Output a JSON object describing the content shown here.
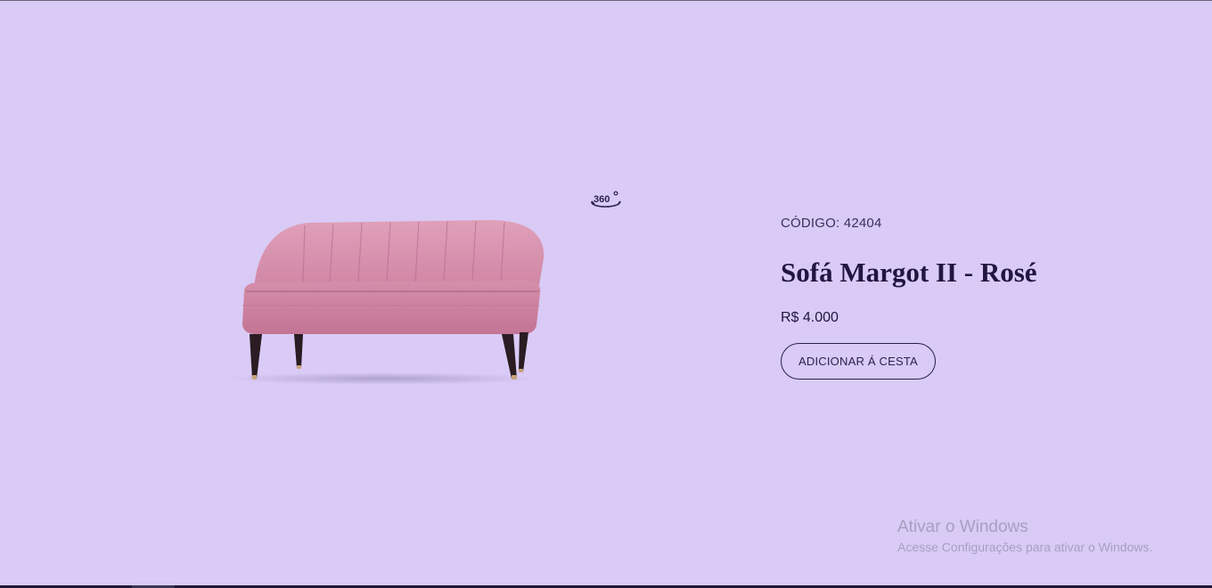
{
  "product": {
    "code_label": "CÓDIGO:",
    "code_value": "42404",
    "title": "Sofá Margot II - Rosé",
    "price": "R$ 4.000",
    "add_to_cart_label": "ADICIONAR Á CESTA",
    "view_360_icon": "360-view-icon",
    "view_360_text": "360°",
    "image_name": "pink-sofa-image"
  },
  "colors": {
    "background": "#d9cbf6",
    "text": "#221640",
    "sofa": "#d48aa8"
  },
  "windows_watermark": {
    "title": "Ativar o Windows",
    "subtitle": "Acesse Configurações para ativar o Windows."
  }
}
